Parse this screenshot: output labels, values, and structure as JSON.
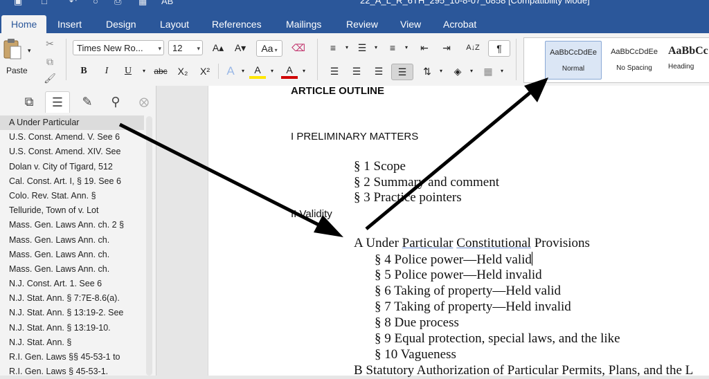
{
  "window": {
    "title": "22_A_L_R_6TH_295_10-8-07_0858 [Compatibility Mode]",
    "title_partial": "AB"
  },
  "ribbon_tabs": [
    "Home",
    "Insert",
    "Design",
    "Layout",
    "References",
    "Mailings",
    "Review",
    "View",
    "Acrobat"
  ],
  "toolbar": {
    "paste_label": "Paste",
    "font_name": "Times New Ro...",
    "font_size": "12",
    "bold": "B",
    "italic": "I",
    "underline": "U",
    "strikethrough": "abc",
    "subscript": "X₂",
    "superscript": "X²",
    "text_effects": "A",
    "highlight": "A",
    "font_color": "A",
    "grow_font": "A▴",
    "shrink_font": "A▾",
    "change_case": "Aa",
    "pilcrow": "¶",
    "sort": "A↓Z"
  },
  "styles": [
    {
      "sample": "AaBbCcDdEe",
      "name": "Normal"
    },
    {
      "sample": "AaBbCcDdEe",
      "name": "No Spacing"
    },
    {
      "sample": "AaBbCc",
      "name": "Heading"
    }
  ],
  "nav_items": [
    "A Under Particular",
    "U.S. Const. Amend. V. See 6",
    "U.S. Const. Amend. XIV. See",
    "Dolan v. City of Tigard, 512",
    "Cal. Const. Art. I, § 19. See 6",
    "Colo. Rev. Stat. Ann. §",
    "Telluride, Town of v. Lot",
    "Mass. Gen. Laws Ann. ch. 2 §",
    "Mass. Gen. Laws Ann. ch.",
    "Mass. Gen. Laws Ann. ch.",
    "Mass. Gen. Laws Ann. ch.",
    "N.J. Const. Art. 1. See 6",
    "N.J. Stat. Ann. § 7:7E-8.6(a).",
    "N.J. Stat. Ann. § 13:19-2. See",
    "N.J. Stat. Ann. § 13:19-10.",
    "N.J. Stat. Ann. §",
    "R.I. Gen. Laws §§ 45-53-1 to",
    "R.I. Gen. Laws § 45-53-1."
  ],
  "document": {
    "article_outline": "ARTICLE OUTLINE",
    "preliminary": "I PRELIMINARY MATTERS",
    "sec1": "§ 1 Scope",
    "sec2": "§ 2 Summary and comment",
    "sec3": "§ 3 Practice pointers",
    "validity": "II Validity",
    "a_prefix": "A Under ",
    "a_particular": "Particular",
    "a_constitutional": "Constitutional",
    "a_suffix": " Provisions",
    "sec4": "§ 4 Police power—Held valid",
    "sec5": "§ 5 Police power—Held invalid",
    "sec6": "§ 6 Taking of property—Held valid",
    "sec7": "§ 7 Taking of property—Held invalid",
    "sec8": "§ 8 Due process",
    "sec9": "§ 9 Equal protection, special laws, and the like",
    "sec10": "§ 10 Vagueness",
    "b_heading": "B Statutory Authorization of Particular Permits, Plans, and the L"
  },
  "colors": {
    "ribbon_blue": "#2b579a",
    "arrow": "#000000",
    "highlight_yellow": "#ffe600",
    "font_red": "#d00000"
  }
}
